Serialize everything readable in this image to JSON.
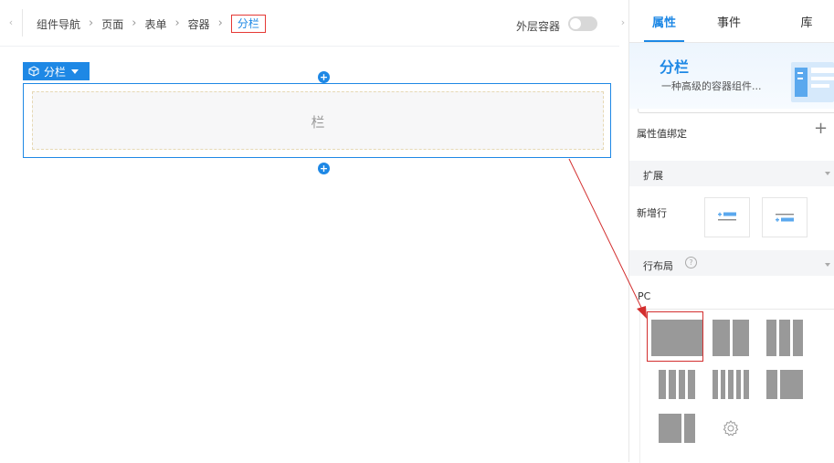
{
  "topbar": {
    "breadcrumb": [
      "组件导航",
      "页面",
      "表单",
      "容器"
    ],
    "breadcrumb_current": "分栏",
    "separator": "›",
    "outer_container_label": "外层容器",
    "outer_container_enabled": false,
    "left_collapse_icon": "‹",
    "right_collapse_icon": "›"
  },
  "canvas": {
    "component_tag": "分栏",
    "add_button_glyph": "+",
    "column_placeholder": "栏"
  },
  "panel": {
    "tabs": [
      {
        "label": "属性",
        "active": true
      },
      {
        "label": "事件",
        "active": false
      },
      {
        "label": "库",
        "active": false
      }
    ],
    "component": {
      "title": "分栏",
      "description": "一种高级的容器组件..."
    },
    "binding": {
      "label": "属性值绑定",
      "add_glyph": "+"
    },
    "extend": {
      "title": "扩展",
      "new_row_label": "新增行"
    },
    "layout": {
      "title": "行布局",
      "help_glyph": "?",
      "platform_label": "PC",
      "options": [
        "1",
        "1:1",
        "1:1:1",
        "1:1:1:1",
        "1:1:1:1:1",
        "1:2",
        "2:1"
      ],
      "selected": "1"
    }
  },
  "colors": {
    "accent": "#1e88e5",
    "highlight_box": "#e53935",
    "annotation_arrow": "#d32f2f"
  }
}
